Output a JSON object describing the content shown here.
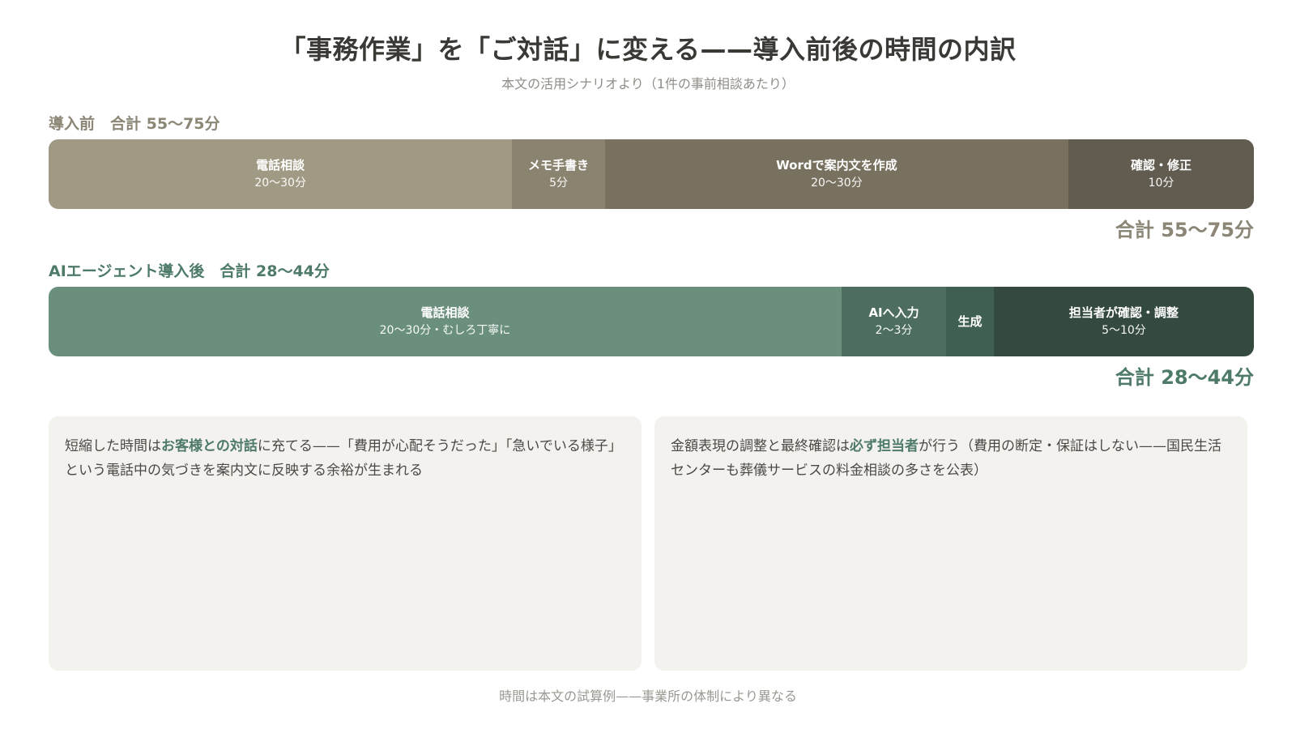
{
  "title": "「事務作業」を「ご対話」に変える——導入前後の時間の内訳",
  "subtitle": "本文の活用シナリオより（1件の事前相談あたり）",
  "chart_data": {
    "type": "bar",
    "orientation": "horizontal-stacked",
    "title": "「事務作業」を「ご対話」に変える——導入前後の時間の内訳",
    "subtitle": "本文の活用シナリオより（1件の事前相談あたり）",
    "unit": "分",
    "rows": [
      {
        "key": "before",
        "label": "導入前　合計 55〜75分",
        "total_label": "合計 55〜75分",
        "color_label": "#8b8676",
        "segments": [
          {
            "label": "電話相談",
            "time": "20〜30分",
            "value": 25,
            "color": "#a09a84"
          },
          {
            "label": "メモ手書き",
            "time": "5分",
            "value": 5,
            "color": "#8a8370"
          },
          {
            "label": "Wordで案内文を作成",
            "time": "20〜30分",
            "value": 25,
            "color": "#787160"
          },
          {
            "label": "確認・修正",
            "time": "10分",
            "value": 10,
            "color": "#615c4f"
          }
        ]
      },
      {
        "key": "after",
        "label": "AIエージェント導入後　合計 28〜44分",
        "total_label": "合計 28〜44分",
        "color_label": "#4e7a68",
        "segments": [
          {
            "label": "電話相談",
            "time": "20〜30分・むしろ丁寧に",
            "value": 25,
            "color": "#6a8f7c"
          },
          {
            "label": "AIへ入力",
            "time": "2〜3分",
            "value": 3.3,
            "color": "#4d6e5f"
          },
          {
            "label": "生成",
            "time": "",
            "value": 1.5,
            "color": "#3f5f50"
          },
          {
            "label": "担当者が確認・調整",
            "time": "5〜10分",
            "value": 8.2,
            "color": "#344a3f"
          }
        ]
      }
    ]
  },
  "cards": [
    {
      "parts": [
        {
          "text": "短縮した時間は",
          "hl": false
        },
        {
          "text": "お客様との対話",
          "hl": true
        },
        {
          "text": "に充てる——「費用が心配そうだった」「急いでいる様子」という電話中の気づきを案内文に反映する余裕が生まれる",
          "hl": false
        }
      ]
    },
    {
      "parts": [
        {
          "text": "金額表現の調整と最終確認は",
          "hl": false
        },
        {
          "text": "必ず担当者",
          "hl": true
        },
        {
          "text": "が行う（費用の断定・保証はしない——国民生活センターも葬儀サービスの料金相談の多さを公表）",
          "hl": false
        }
      ]
    }
  ],
  "footer": "時間は本文の試算例——事業所の体制により異なる"
}
